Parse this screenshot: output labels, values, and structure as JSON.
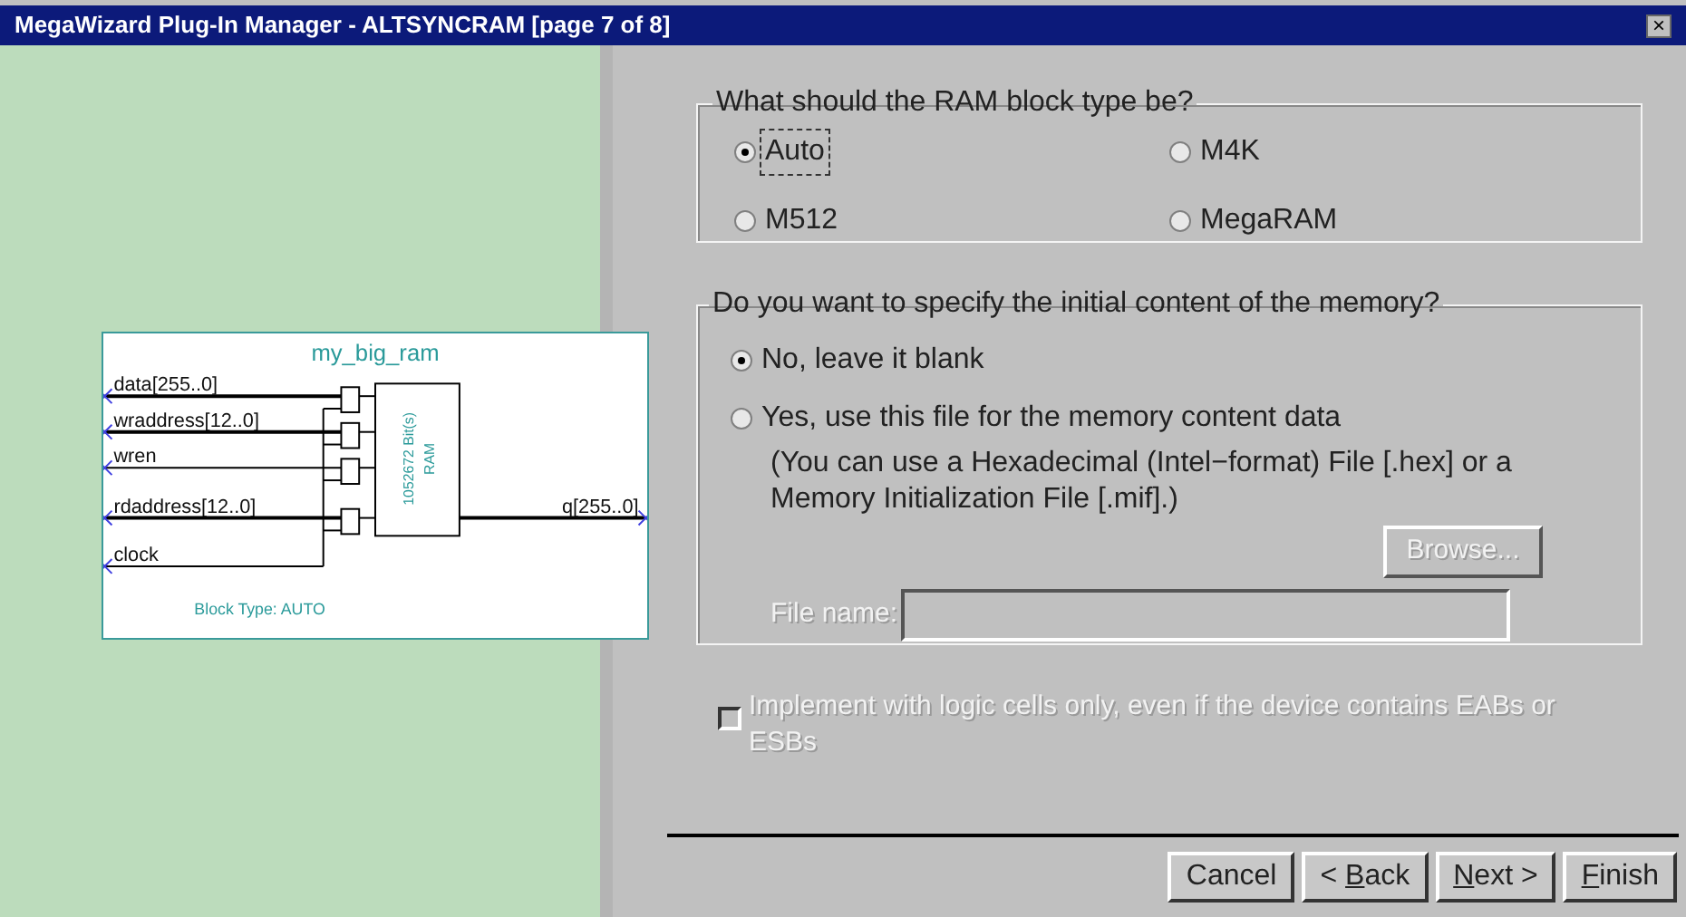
{
  "window": {
    "title": "MegaWizard Plug-In Manager - ALTSYNCRAM [page 7 of 8]",
    "close": "×"
  },
  "diagram": {
    "name": "my_big_ram",
    "block_label": "1052672 Bit(s)",
    "block_type": "RAM",
    "footer": "Block Type: AUTO",
    "inputs": [
      "data[255..0]",
      "wraddress[12..0]",
      "wren",
      "rdaddress[12..0]",
      "clock"
    ],
    "output": "q[255..0]"
  },
  "ram_type": {
    "legend": "What should the RAM block type be?",
    "options": [
      {
        "label": "Auto",
        "selected": true
      },
      {
        "label": "M4K",
        "selected": false
      },
      {
        "label": "M512",
        "selected": false
      },
      {
        "label": "MegaRAM",
        "selected": false
      }
    ]
  },
  "initial_content": {
    "legend": "Do you want to specify the initial content of the memory?",
    "options": [
      {
        "label": "No, leave it blank",
        "selected": true
      },
      {
        "label": "Yes, use this file for the memory content data",
        "selected": false
      }
    ],
    "note": "(You can use a Hexadecimal (Intel−format) File [.hex] or a Memory Initialization File [.mif].)",
    "browse": {
      "label": "Browse...",
      "disabled": true
    },
    "file_name": {
      "label": "File name:",
      "disabled": true
    }
  },
  "logic_cells": {
    "label": "Implement with logic cells only, even if the device contains EABs or ESBs",
    "checked": false,
    "disabled": true
  },
  "buttons": [
    {
      "before": "Cancel"
    },
    {
      "before": "< ",
      "key": "B",
      "after": "ack"
    },
    {
      "key": "N",
      "after": "ext >"
    },
    {
      "key": "F",
      "after": "inish"
    }
  ]
}
